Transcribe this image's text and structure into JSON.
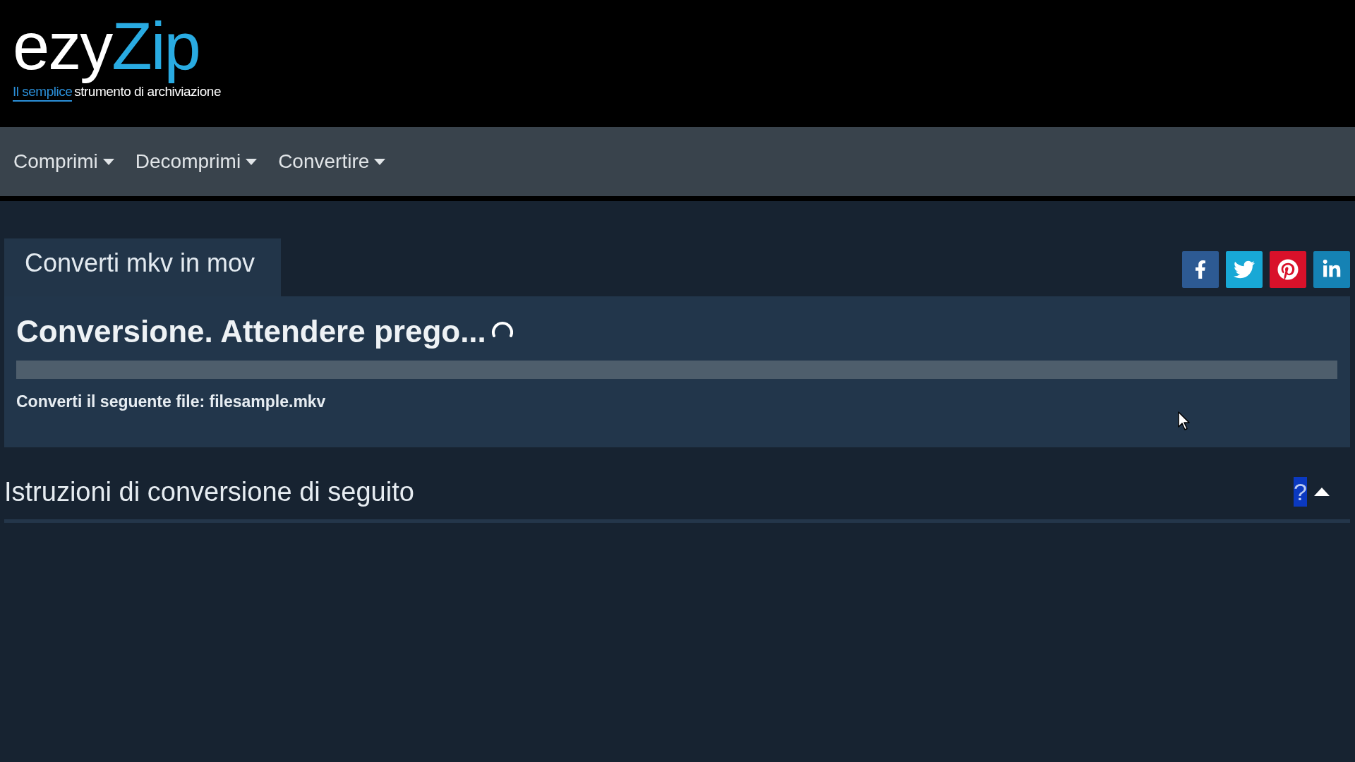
{
  "logo": {
    "name": "ezy",
    "name_accent": "Zip",
    "tagline_accent": "Il semplice",
    "tagline": "strumento di archiviazione"
  },
  "nav": [
    {
      "label": "Comprimi"
    },
    {
      "label": "Decomprimi"
    },
    {
      "label": "Convertire"
    }
  ],
  "tab": {
    "label": "Converti mkv in mov",
    "selected": true
  },
  "share_buttons": [
    {
      "kind": "facebook",
      "color": "#2d5a93"
    },
    {
      "kind": "twitter",
      "color": "#18a8d6"
    },
    {
      "kind": "pinterest",
      "color": "#d9112a"
    },
    {
      "kind": "linkedin",
      "color": "#1582b4"
    }
  ],
  "conversion": {
    "title": "Conversione. Attendere prego...",
    "loading": true,
    "message": "Converti il seguente file: filesample.mkv"
  },
  "instructions": {
    "title": "Istruzioni di conversione di seguito",
    "help": {
      "text": "?",
      "highlighted": true
    },
    "expanded": true
  }
}
